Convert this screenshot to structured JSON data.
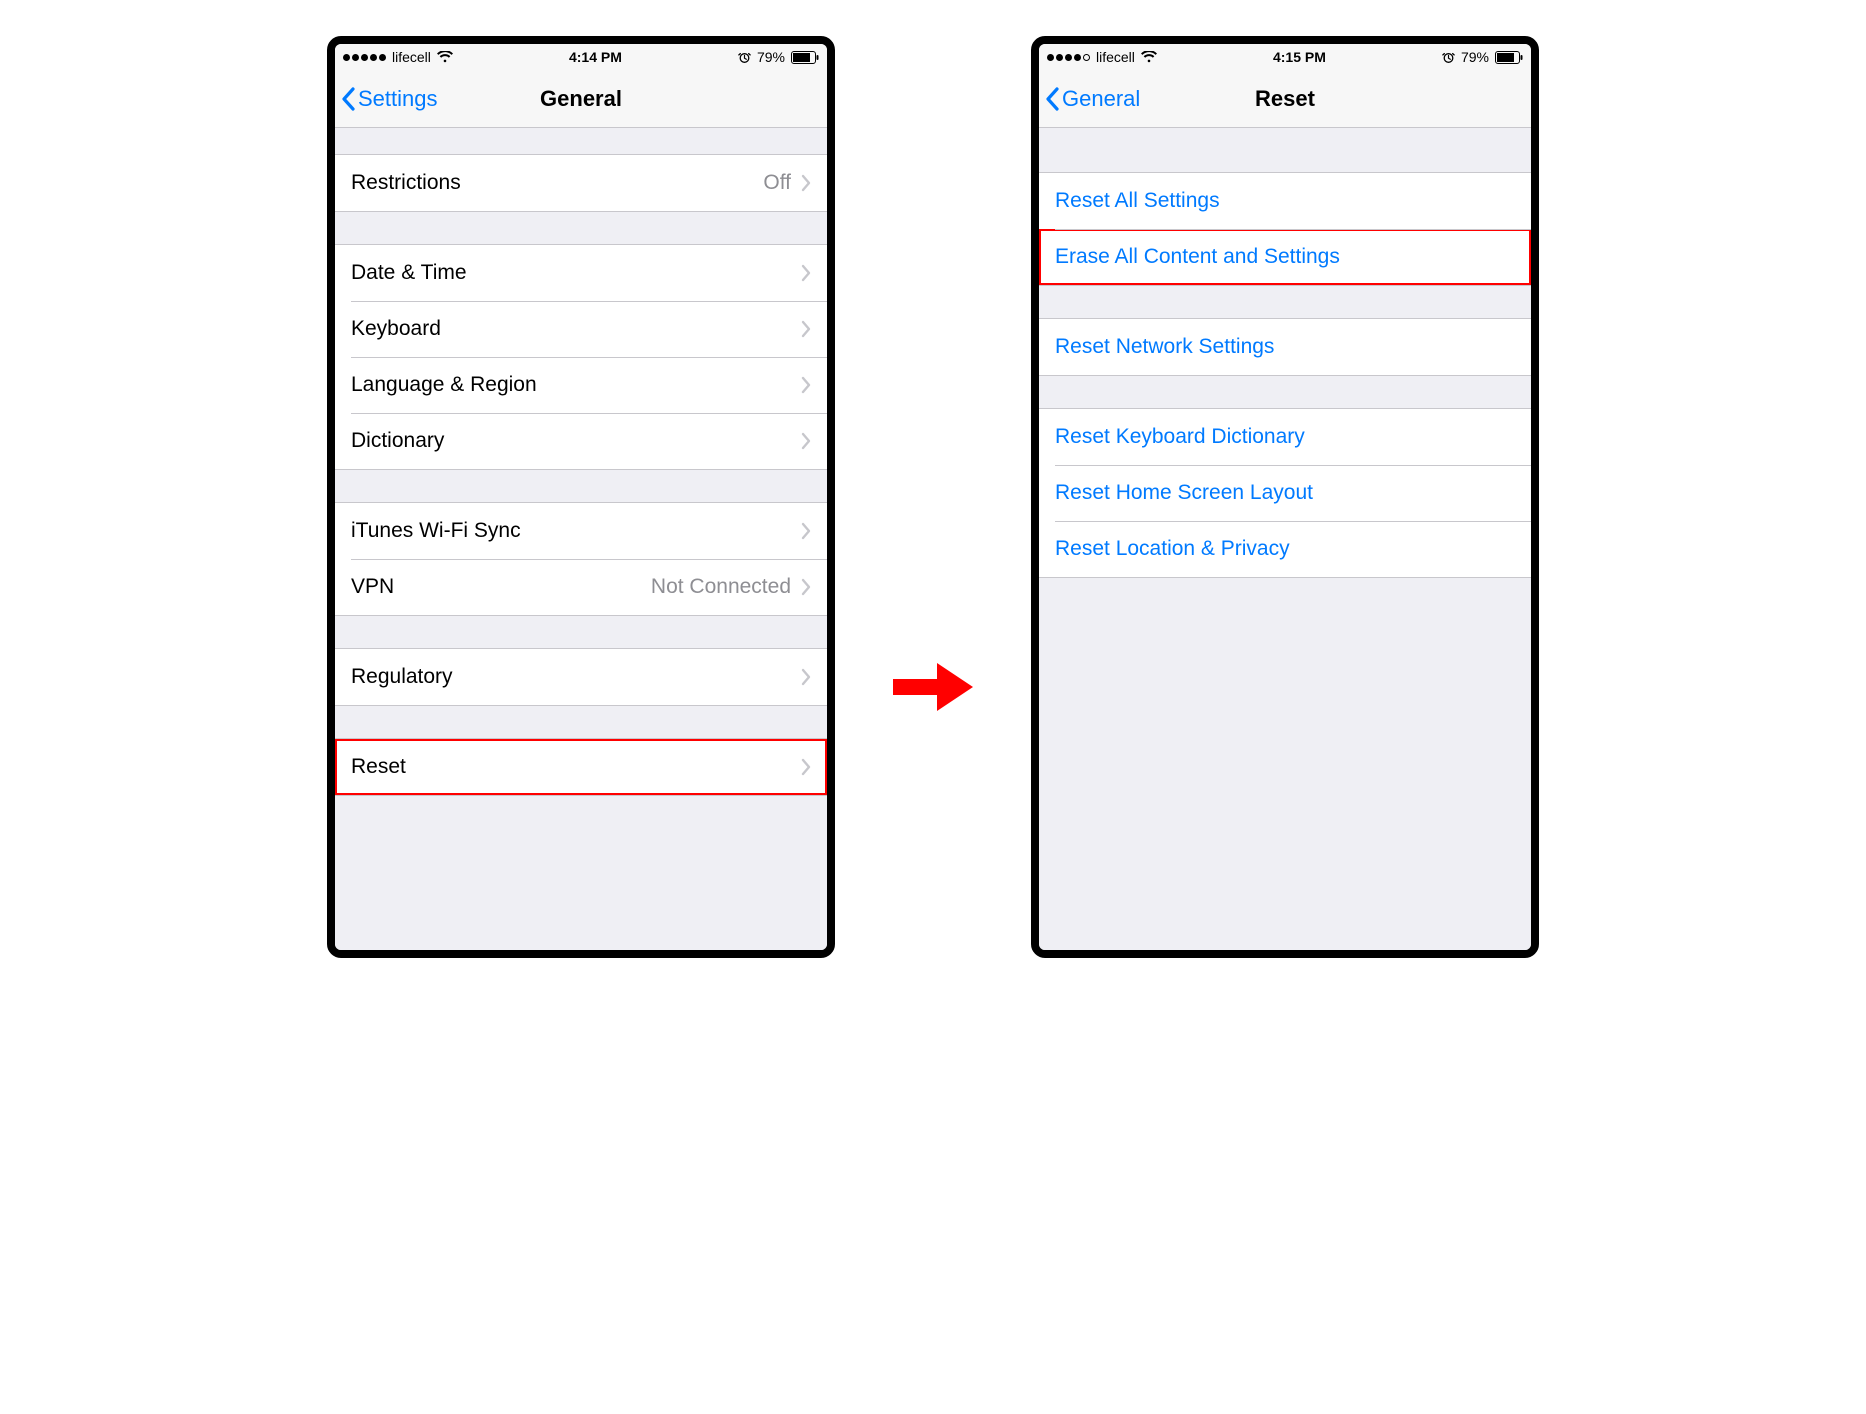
{
  "left": {
    "status": {
      "carrier": "lifecell",
      "time": "4:14 PM",
      "battery": "79%",
      "signal_full": 5,
      "signal_total": 5
    },
    "nav": {
      "back": "Settings",
      "title": "General"
    },
    "groups": [
      {
        "rows": [
          {
            "label": "Restrictions",
            "value": "Off",
            "chevron": true
          }
        ]
      },
      {
        "rows": [
          {
            "label": "Date & Time",
            "chevron": true
          },
          {
            "label": "Keyboard",
            "chevron": true
          },
          {
            "label": "Language & Region",
            "chevron": true
          },
          {
            "label": "Dictionary",
            "chevron": true
          }
        ]
      },
      {
        "rows": [
          {
            "label": "iTunes Wi-Fi Sync",
            "chevron": true
          },
          {
            "label": "VPN",
            "value": "Not Connected",
            "chevron": true
          }
        ]
      },
      {
        "rows": [
          {
            "label": "Regulatory",
            "chevron": true
          }
        ]
      },
      {
        "rows": [
          {
            "label": "Reset",
            "chevron": true,
            "highlighted": true
          }
        ]
      }
    ]
  },
  "right": {
    "status": {
      "carrier": "lifecell",
      "time": "4:15 PM",
      "battery": "79%",
      "signal_full": 4,
      "signal_total": 5
    },
    "nav": {
      "back": "General",
      "title": "Reset"
    },
    "groups": [
      {
        "rows": [
          {
            "label": "Reset All Settings",
            "link": true
          },
          {
            "label": "Erase All Content and Settings",
            "link": true,
            "highlighted": true
          }
        ]
      },
      {
        "rows": [
          {
            "label": "Reset Network Settings",
            "link": true
          }
        ]
      },
      {
        "rows": [
          {
            "label": "Reset Keyboard Dictionary",
            "link": true
          },
          {
            "label": "Reset Home Screen Layout",
            "link": true
          },
          {
            "label": "Reset Location & Privacy",
            "link": true
          }
        ]
      }
    ]
  }
}
